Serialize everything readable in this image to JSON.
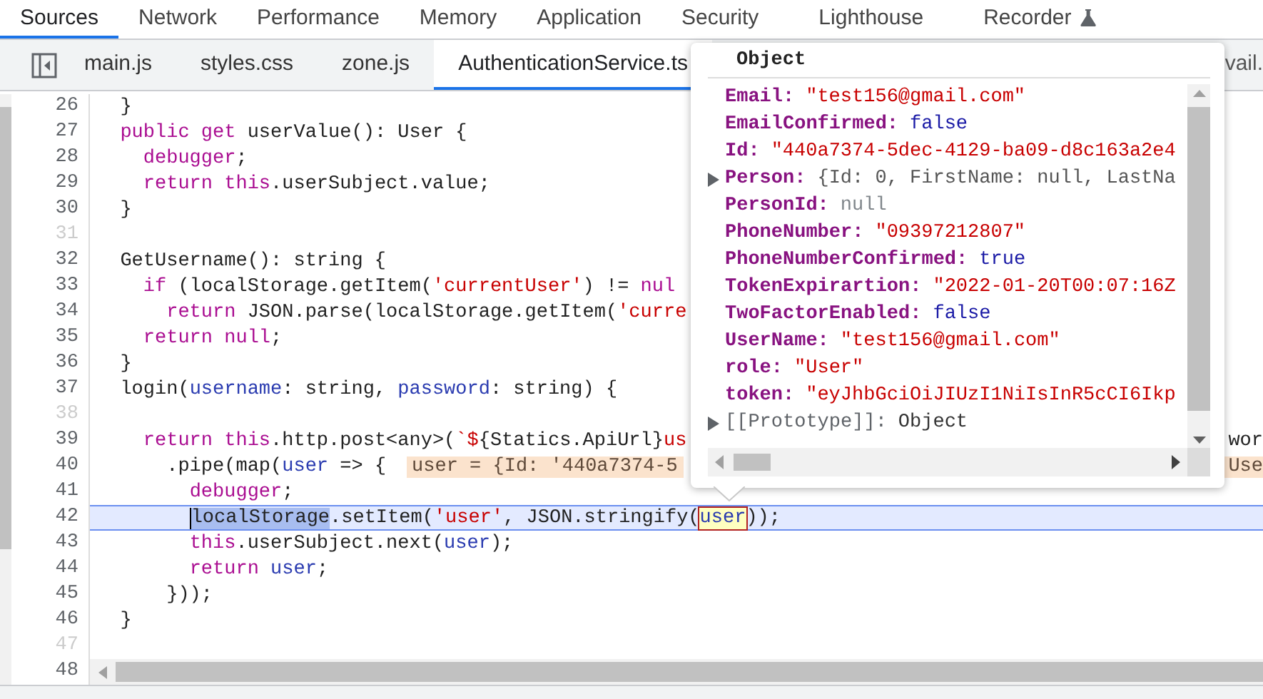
{
  "panel_tabs": [
    {
      "label": "Sources",
      "selected": true,
      "experimental": false
    },
    {
      "label": "Network",
      "selected": false,
      "experimental": false
    },
    {
      "label": "Performance",
      "selected": false,
      "experimental": false
    },
    {
      "label": "Memory",
      "selected": false,
      "experimental": false
    },
    {
      "label": "Application",
      "selected": false,
      "experimental": false
    },
    {
      "label": "Security",
      "selected": false,
      "experimental": false
    },
    {
      "label": "Lighthouse",
      "selected": false,
      "experimental": false
    },
    {
      "label": "Recorder",
      "selected": false,
      "experimental": true
    }
  ],
  "file_tabs": [
    {
      "label": "main.js",
      "selected": false
    },
    {
      "label": "styles.css",
      "selected": false
    },
    {
      "label": "zone.js",
      "selected": false
    },
    {
      "label": "AuthenticationService.ts",
      "selected": true
    },
    {
      "label": "vail.",
      "selected": false
    }
  ],
  "editor": {
    "lines": [
      {
        "number": "26",
        "breakable": true,
        "current": false,
        "tokens": [
          {
            "text": "  }",
            "kind": "plain"
          }
        ]
      },
      {
        "number": "27",
        "breakable": true,
        "current": false,
        "tokens": [
          {
            "text": "  public get",
            "kind": "keyword"
          },
          {
            "text": " userValue(): User {",
            "kind": "plain"
          }
        ]
      },
      {
        "number": "28",
        "breakable": true,
        "current": false,
        "tokens": [
          {
            "text": "    debugger",
            "kind": "keyword"
          },
          {
            "text": ";",
            "kind": "plain"
          }
        ]
      },
      {
        "number": "29",
        "breakable": true,
        "current": false,
        "tokens": [
          {
            "text": "    return this",
            "kind": "keyword"
          },
          {
            "text": ".userSubject.value;",
            "kind": "plain"
          }
        ]
      },
      {
        "number": "30",
        "breakable": true,
        "current": false,
        "tokens": [
          {
            "text": "  }",
            "kind": "plain"
          }
        ]
      },
      {
        "number": "31",
        "breakable": false,
        "current": false
      },
      {
        "number": "32",
        "breakable": true,
        "current": false,
        "tokens": [
          {
            "text": "  GetUsername(): string {",
            "kind": "plain"
          }
        ]
      },
      {
        "number": "33",
        "breakable": true,
        "current": false,
        "tokens": [
          {
            "text": "    if",
            "kind": "keyword"
          },
          {
            "text": " (localStorage.getItem(",
            "kind": "plain"
          },
          {
            "text": "'currentUser'",
            "kind": "string"
          },
          {
            "text": ") != ",
            "kind": "plain"
          },
          {
            "text": "nul",
            "kind": "keyword"
          }
        ]
      },
      {
        "number": "34",
        "breakable": true,
        "current": false,
        "tokens": [
          {
            "text": "      return",
            "kind": "keyword"
          },
          {
            "text": " JSON.parse(localStorage.getItem(",
            "kind": "plain"
          },
          {
            "text": "'curre",
            "kind": "string"
          }
        ]
      },
      {
        "number": "35",
        "breakable": true,
        "current": false,
        "tokens": [
          {
            "text": "    return null",
            "kind": "keyword"
          },
          {
            "text": ";",
            "kind": "plain"
          }
        ]
      },
      {
        "number": "36",
        "breakable": true,
        "current": false,
        "tokens": [
          {
            "text": "  }",
            "kind": "plain"
          }
        ]
      },
      {
        "number": "37",
        "breakable": true,
        "current": false,
        "tokens": [
          {
            "text": "  login(",
            "kind": "plain"
          },
          {
            "text": "username",
            "kind": "variable"
          },
          {
            "text": ": string, ",
            "kind": "plain"
          },
          {
            "text": "password",
            "kind": "variable"
          },
          {
            "text": ": string) {",
            "kind": "plain"
          }
        ]
      },
      {
        "number": "38",
        "breakable": false,
        "current": false
      },
      {
        "number": "39",
        "breakable": true,
        "current": false,
        "tokens": [
          {
            "text": "    return this",
            "kind": "keyword"
          },
          {
            "text": ".http.post<any>(",
            "kind": "plain"
          },
          {
            "text": "`$",
            "kind": "string"
          },
          {
            "text": "{Statics.ApiUrl}",
            "kind": "plain"
          },
          {
            "text": "us",
            "kind": "string"
          }
        ],
        "right_fragment": {
          "text": "wor",
          "kind": "code"
        }
      },
      {
        "number": "40",
        "breakable": true,
        "current": false,
        "tokens": [
          {
            "text": "      .pipe(map(",
            "kind": "plain"
          },
          {
            "text": "user",
            "kind": "variable"
          },
          {
            "text": " => {",
            "kind": "plain"
          }
        ],
        "inline_value": "user = {Id: '440a7374-5",
        "right_fragment": {
          "text": "Use",
          "kind": "inline-value"
        }
      },
      {
        "number": "41",
        "breakable": true,
        "current": false,
        "tokens": [
          {
            "text": "        debugger",
            "kind": "keyword"
          },
          {
            "text": ";",
            "kind": "plain"
          }
        ]
      },
      {
        "number": "42",
        "breakable": true,
        "current": true,
        "tokens": [
          {
            "text": "        localStorage",
            "kind": "selected"
          },
          {
            "text": ".setItem(",
            "kind": "plain"
          },
          {
            "text": "'user'",
            "kind": "string"
          },
          {
            "text": ", JSON.stringify(",
            "kind": "plain"
          },
          {
            "text": "user",
            "kind": "hovered"
          },
          {
            "text": "));",
            "kind": "plain"
          }
        ]
      },
      {
        "number": "43",
        "breakable": true,
        "current": false,
        "tokens": [
          {
            "text": "        this",
            "kind": "keyword"
          },
          {
            "text": ".userSubject.next(",
            "kind": "plain"
          },
          {
            "text": "user",
            "kind": "variable"
          },
          {
            "text": ");",
            "kind": "plain"
          }
        ]
      },
      {
        "number": "44",
        "breakable": true,
        "current": false,
        "tokens": [
          {
            "text": "        return ",
            "kind": "keyword"
          },
          {
            "text": "user",
            "kind": "variable"
          },
          {
            "text": ";",
            "kind": "plain"
          }
        ]
      },
      {
        "number": "45",
        "breakable": true,
        "current": false,
        "tokens": [
          {
            "text": "      }));",
            "kind": "plain"
          }
        ]
      },
      {
        "number": "46",
        "breakable": true,
        "current": false,
        "tokens": [
          {
            "text": "  }",
            "kind": "plain"
          }
        ]
      },
      {
        "number": "47",
        "breakable": false,
        "current": false
      },
      {
        "number": "48",
        "breakable": true,
        "current": false
      }
    ]
  },
  "popover": {
    "title": "Object",
    "properties": [
      {
        "key": "Email:",
        "value": "\"test156@gmail.com\"",
        "kind": "string",
        "expandable": false
      },
      {
        "key": "EmailConfirmed:",
        "value": "false",
        "kind": "boolean",
        "expandable": false
      },
      {
        "key": "Id:",
        "value": "\"440a7374-5dec-4129-ba09-d8c163a2e4",
        "kind": "string",
        "expandable": false
      },
      {
        "key": "Person:",
        "value": "{Id: 0, FirstName: null, LastNa",
        "kind": "object",
        "expandable": true
      },
      {
        "key": "PersonId:",
        "value": "null",
        "kind": "null",
        "expandable": false
      },
      {
        "key": "PhoneNumber:",
        "value": "\"09397212807\"",
        "kind": "string",
        "expandable": false
      },
      {
        "key": "PhoneNumberConfirmed:",
        "value": "true",
        "kind": "boolean",
        "expandable": false
      },
      {
        "key": "TokenExpirartion:",
        "value": "\"2022-01-20T00:07:16Z",
        "kind": "string",
        "expandable": false
      },
      {
        "key": "TwoFactorEnabled:",
        "value": "false",
        "kind": "boolean",
        "expandable": false
      },
      {
        "key": "UserName:",
        "value": "\"test156@gmail.com\"",
        "kind": "string",
        "expandable": false
      },
      {
        "key": "role:",
        "value": "\"User\"",
        "kind": "string",
        "expandable": false
      },
      {
        "key": "token:",
        "value": "\"eyJhbGciOiJIUzI1NiIsInR5cCI6Ikp",
        "kind": "string",
        "expandable": false
      },
      {
        "key": "[[Prototype]]:",
        "value": "Object",
        "kind": "internal",
        "expandable": true
      }
    ]
  }
}
